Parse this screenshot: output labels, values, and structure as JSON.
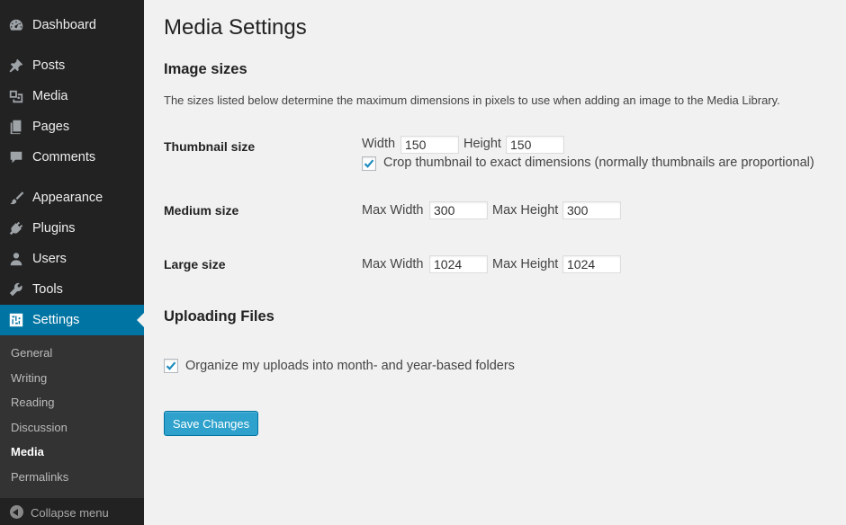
{
  "sidebar": {
    "items": [
      {
        "label": "Dashboard",
        "icon": "dashboard-icon"
      },
      {
        "label": "Posts",
        "icon": "pin-icon"
      },
      {
        "label": "Media",
        "icon": "media-icon"
      },
      {
        "label": "Pages",
        "icon": "pages-icon"
      },
      {
        "label": "Comments",
        "icon": "comment-icon"
      },
      {
        "label": "Appearance",
        "icon": "brush-icon"
      },
      {
        "label": "Plugins",
        "icon": "plug-icon"
      },
      {
        "label": "Users",
        "icon": "user-icon"
      },
      {
        "label": "Tools",
        "icon": "wrench-icon"
      },
      {
        "label": "Settings",
        "icon": "settings-icon"
      }
    ],
    "current": "Settings",
    "submenu": [
      "General",
      "Writing",
      "Reading",
      "Discussion",
      "Media",
      "Permalinks"
    ],
    "current_sub": "Media",
    "collapse_label": "Collapse menu",
    "accent_color": "#0074a2"
  },
  "main": {
    "title": "Media Settings",
    "image_sizes": {
      "heading": "Image sizes",
      "description": "The sizes listed below determine the maximum dimensions in pixels to use when adding an image to the Media Library.",
      "thumbnail": {
        "label": "Thumbnail size",
        "width_label": "Width",
        "width": "150",
        "height_label": "Height",
        "height": "150",
        "crop_label": "Crop thumbnail to exact dimensions (normally thumbnails are proportional)",
        "crop_checked": true
      },
      "medium": {
        "label": "Medium size",
        "max_width_label": "Max Width",
        "max_width": "300",
        "max_height_label": "Max Height",
        "max_height": "300"
      },
      "large": {
        "label": "Large size",
        "max_width_label": "Max Width",
        "max_width": "1024",
        "max_height_label": "Max Height",
        "max_height": "1024"
      }
    },
    "uploading": {
      "heading": "Uploading Files",
      "organize_label": "Organize my uploads into month- and year-based folders",
      "organize_checked": true
    },
    "save_label": "Save Changes"
  }
}
